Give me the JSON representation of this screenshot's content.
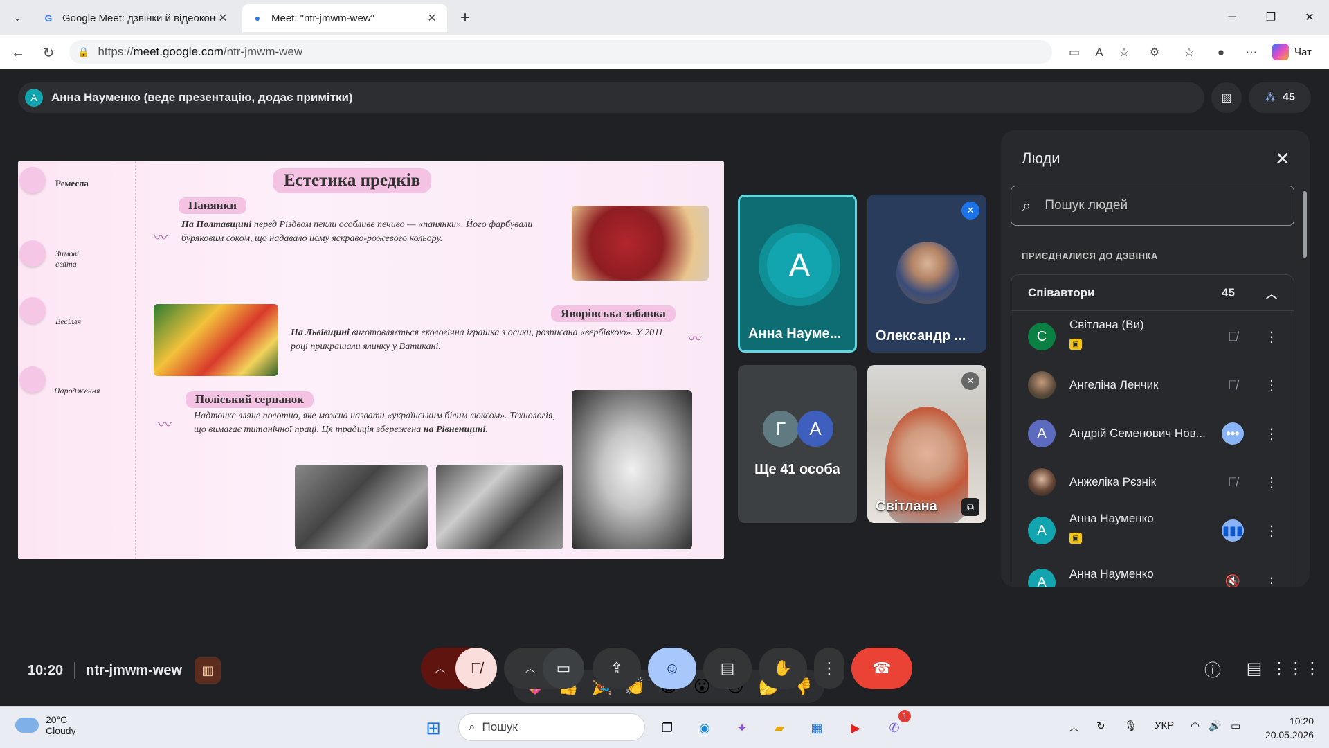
{
  "browser": {
    "tabs": [
      {
        "title": "Google Meet: дзвінки й відеоконф",
        "icon": "G"
      },
      {
        "title": "Meet: \"ntr-jmwm-wew\"",
        "icon": "●"
      }
    ],
    "url_prefix": "https://",
    "url_host": "meet.google.com",
    "url_path": "/ntr-jmwm-wew",
    "chat_label": "Чат"
  },
  "meeting": {
    "presenter_initial": "А",
    "presenter_text": "Анна Науменко (веде презентацію, додає примітки)",
    "participant_count": "45",
    "time": "10:20",
    "code": "ntr-jmwm-wew"
  },
  "slide": {
    "title": "Естетика предків",
    "sidebar": [
      "Ремесла",
      "Зимові свята",
      "Весілля",
      "Народження"
    ],
    "section1_title": "Панянки",
    "section1_text_bold": "На Полтавщині",
    "section1_text": " перед Різдвом пекли особливе печиво — «панянки». Його фарбували буряковим соком, що надавало йому яскраво-рожевого кольору.",
    "section2_title": "Яворівська забавка",
    "section2_text_bold": "На Львівщині",
    "section2_text": " виготовляється екологічна іграшка з осики, розписана «вербівкою». У 2011 році прикрашали ялинку у Ватикані.",
    "section3_title": "Поліський серпанок",
    "section3_text": "Надтонке лляне полотно, яке можна назвати «українським білим люксом». Технологія, що вимагає титанічної праці. Ця традиція збережена ",
    "section3_text_bold": "на Рівненщині."
  },
  "tiles": [
    {
      "name": "Анна Науме...",
      "initial": "А"
    },
    {
      "name": "Олександр ..."
    },
    {
      "name": "Ще 41 особа",
      "initials": [
        "Г",
        "А"
      ]
    },
    {
      "name": "Світлана"
    }
  ],
  "panel": {
    "title": "Люди",
    "search_placeholder": "Пошук людей",
    "section_label": "ПРИЄДНАЛИСЯ ДО ДЗВІНКА",
    "group_label": "Співавтори",
    "group_count": "45",
    "people": [
      {
        "name": "Світлана (Ви)",
        "initial": "С",
        "color": "#0b8043"
      },
      {
        "name": "Ангеліна Ленчик"
      },
      {
        "name": "Андрій Семенович Нов...",
        "initial": "А",
        "color": "#5c6bc0"
      },
      {
        "name": "Анжеліка Рєзнік"
      },
      {
        "name": "Анна Науменко",
        "initial": "А",
        "color": "#12a4af"
      },
      {
        "name": "Анна Науменко",
        "initial": "А",
        "color": "#12a4af"
      }
    ]
  },
  "reactions": [
    "💖",
    "👍",
    "🎉",
    "👏",
    "😂",
    "😮",
    "😢",
    "🤔",
    "👎"
  ],
  "taskbar": {
    "temp": "20°C",
    "weather": "Cloudy",
    "search_placeholder": "Пошук",
    "lang": "УКР",
    "time": "10:20",
    "date": "20.05.2026",
    "viber_badge": "1"
  },
  "colors": {
    "meet_bg": "#202124",
    "end_call": "#ea4335",
    "presenter_avatar": "#12a4af",
    "reaction_active": "#a8c7fa"
  }
}
